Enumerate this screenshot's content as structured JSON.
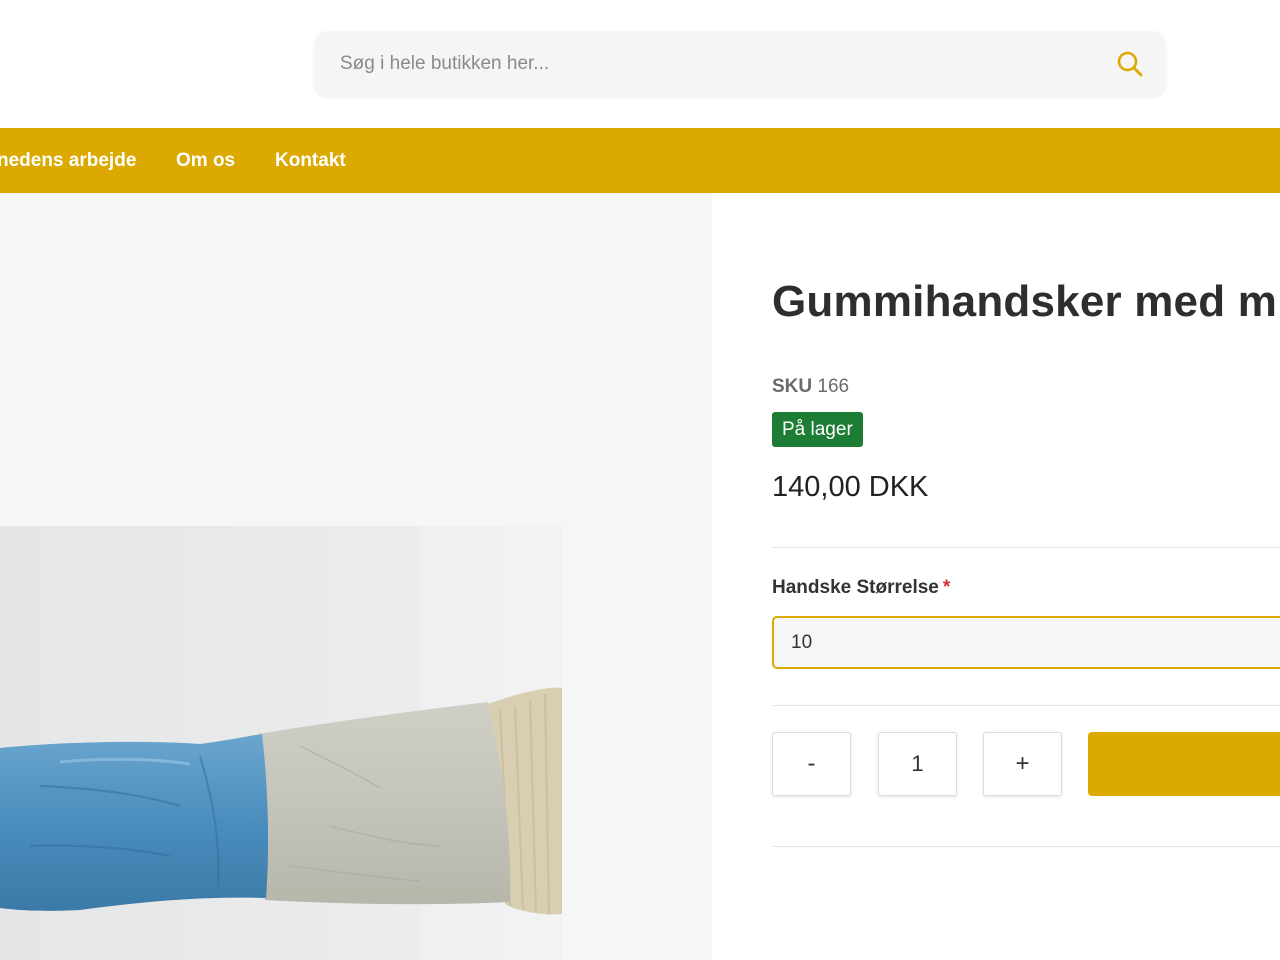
{
  "colors": {
    "brand": "#dba900",
    "stock_badge": "#1e7d34"
  },
  "search": {
    "placeholder": "Søg i hele butikken her...",
    "icon": "search-icon"
  },
  "nav": {
    "items": [
      {
        "label": "nedens arbejde"
      },
      {
        "label": "Om os"
      },
      {
        "label": "Kontakt"
      }
    ]
  },
  "product": {
    "title": "Gummihandsker med m",
    "sku_label": "SKU",
    "sku_value": "166",
    "stock_status": "På lager",
    "price": "140,00 DKK",
    "option_label": "Handske Størrelse",
    "required_marker": "*",
    "size_value": "10",
    "quantity": {
      "decrement_label": "-",
      "value": "1",
      "increment_label": "+"
    }
  }
}
